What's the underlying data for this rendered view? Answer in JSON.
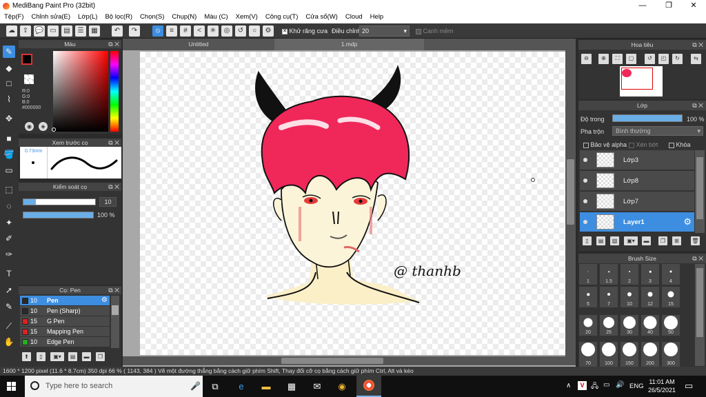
{
  "titlebar": {
    "title": "MediBang Paint Pro (32bit)",
    "minimize": "—",
    "maximize": "❐",
    "close": "✕"
  },
  "menu": [
    "Tệp(F)",
    "Chỉnh sửa(E)",
    "Lớp(L)",
    "Bộ lọc(R)",
    "Chọn(S)",
    "Chụp(N)",
    "Màu (C)",
    "Xem(V)",
    "Công cụ(T)",
    "Cửa sổ(W)",
    "Cloud",
    "Help"
  ],
  "toolbar": {
    "antialias_label": "Khử răng cưa",
    "correction_label": "Điều chỉnh",
    "correction_value": "20",
    "edge_label": "Canh mềm"
  },
  "color_panel": {
    "title": "Màu",
    "r": "R:0",
    "g": "G:0",
    "b": "B:0",
    "hex": "#000000"
  },
  "brush_preview": {
    "title": "Xem trước cọ",
    "size": "0.73mm"
  },
  "brush_control": {
    "title": "Kiểm soát cọ",
    "size_value": "10",
    "opacity_value": "100 %"
  },
  "brush_panel": {
    "title": "Cọ: Pen",
    "items": [
      {
        "size": "10",
        "name": "Pen",
        "color": "#2a2a2a"
      },
      {
        "size": "10",
        "name": "Pen (Sharp)",
        "color": "#2a2a2a"
      },
      {
        "size": "15",
        "name": "G Pen",
        "color": "#e02020"
      },
      {
        "size": "15",
        "name": "Mapping Pen",
        "color": "#e02020"
      },
      {
        "size": "10",
        "name": "Edge Pen",
        "color": "#20b020"
      }
    ]
  },
  "tabs": [
    "Untitled",
    "1.mdp"
  ],
  "navigator": {
    "title": "Hoa tiêu"
  },
  "layer_panel": {
    "title": "Lớp",
    "opacity_label": "Độ trong",
    "opacity_value": "100 %",
    "blend_label": "Pha trộn",
    "blend_value": "Bình thường",
    "protect_alpha": "Bảo vệ alpha",
    "clipping": "Xén bớt",
    "lock": "Khóa",
    "layers": [
      "Lớp3",
      "Lớp8",
      "Lớp7",
      "Layer1"
    ]
  },
  "brush_size_panel": {
    "title": "Brush Size",
    "sizes": [
      "1",
      "1.5",
      "2",
      "3",
      "4",
      "5",
      "7",
      "10",
      "12",
      "15",
      "20",
      "25",
      "30",
      "40",
      "50",
      "70",
      "100",
      "150",
      "200",
      "300"
    ]
  },
  "status": {
    "text": "1600 * 1200 pixel   (11.6 * 8.7cm)   350 dpi   66 %   ( 1143, 384 )   Vẽ một đường thẳng bằng cách giữ phím Shift, Thay đổi cỡ cọ bằng cách giữ phím Ctrl, Alt và kéo"
  },
  "taskbar": {
    "search_placeholder": "Type here to search",
    "time": "11:01 AM",
    "date": "26/5/2021",
    "lang": "ENG"
  },
  "artwork": {
    "signature": "@ thanhb"
  },
  "colors": {
    "accent": "#3d8ee0",
    "hair": "#f0285a",
    "panel": "#2b2b2b"
  }
}
